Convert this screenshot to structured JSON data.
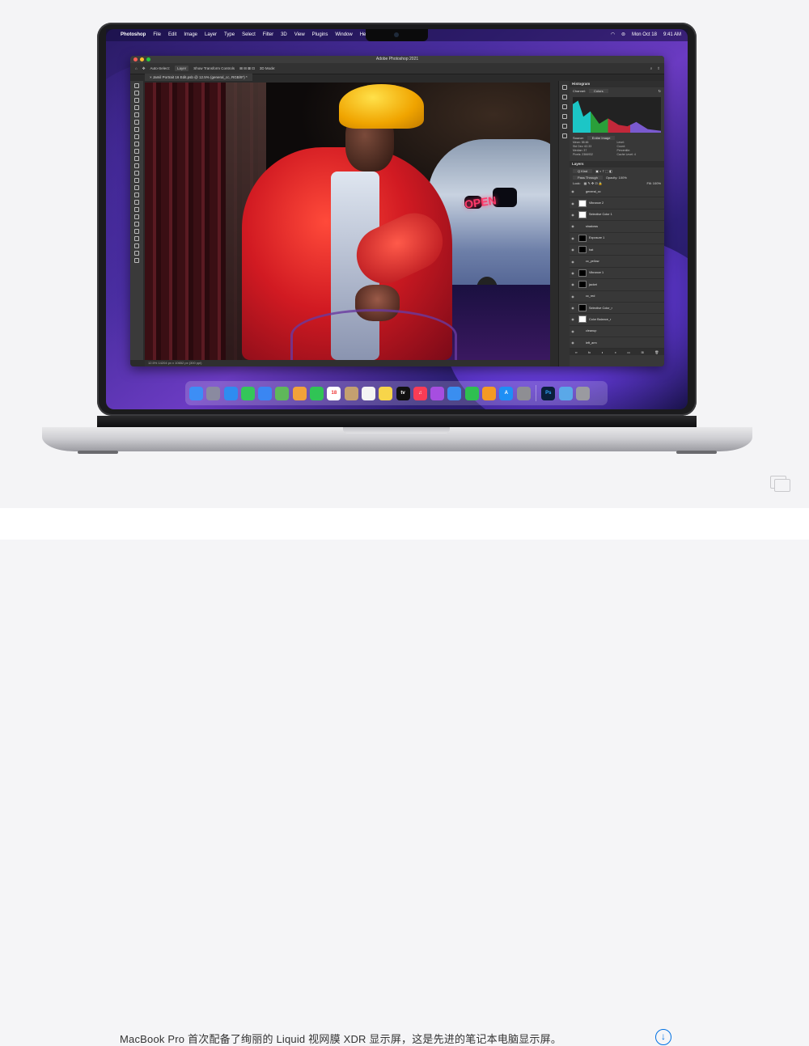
{
  "menubar": {
    "app": "Photoshop",
    "items": [
      "File",
      "Edit",
      "Image",
      "Layer",
      "Type",
      "Select",
      "Filter",
      "3D",
      "View",
      "Plugins",
      "Window",
      "Help"
    ],
    "clock": "Mon Oct 18",
    "time": "9:41 AM"
  },
  "photoshop": {
    "window_title": "Adobe Photoshop 2021",
    "options": {
      "auto_select": "Auto-Select:",
      "auto_select_value": "Layer",
      "show_transform": "Show Transform Controls",
      "mode_3d": "3D Mode:"
    },
    "doc_tab": "Jamil Portrait 16 Edit.psb @ 12.5% (general_cc, RGB/8*) *",
    "status": "12.5%     14204 px x 10652 px (300 ppi)",
    "neon_sign": "OPEN",
    "histogram": {
      "title": "Histogram",
      "channel_label": "Channel:",
      "channel_value": "Colors",
      "source_label": "Source:",
      "source_value": "Entire Image",
      "mean": "Mean:  58.66",
      "std_dev": "Std Dev:  62.33",
      "median": "Median:  37",
      "pixels": "Pixels:  2366932",
      "level": "Level:",
      "count": "Count:",
      "percentile": "Percentile:",
      "cache": "Cache Level:  4"
    },
    "layers": {
      "title": "Layers",
      "kind": "Q Kind",
      "blend": "Pass Through",
      "opacity": "Opacity: 100%",
      "lock": "Lock:",
      "fill": "Fill: 100%",
      "items": [
        {
          "name": "general_cc",
          "thumb": "none"
        },
        {
          "name": "Vibrance 2",
          "thumb": "light"
        },
        {
          "name": "Selective Color 1",
          "thumb": "light"
        },
        {
          "name": "shadows",
          "thumb": "none"
        },
        {
          "name": "Exposure 1",
          "thumb": "dark"
        },
        {
          "name": "hat",
          "thumb": "dark"
        },
        {
          "name": "cc_yellow",
          "thumb": "none"
        },
        {
          "name": "Vibrance 1",
          "thumb": "dark"
        },
        {
          "name": "jacket",
          "thumb": "dark"
        },
        {
          "name": "cc_red",
          "thumb": "none"
        },
        {
          "name": "Selective Color_r",
          "thumb": "dark"
        },
        {
          "name": "Color Balance_r",
          "thumb": "light"
        },
        {
          "name": "cleanup",
          "thumb": "none"
        },
        {
          "name": "left_arm",
          "thumb": "none"
        }
      ]
    }
  },
  "dock": {
    "apps": [
      {
        "icon": "finder-icon",
        "color": "#3d8ef5",
        "label": ""
      },
      {
        "icon": "launchpad-icon",
        "color": "#8a8aa0",
        "label": ""
      },
      {
        "icon": "safari-icon",
        "color": "#2e8cf0",
        "label": ""
      },
      {
        "icon": "messages-icon",
        "color": "#34c759",
        "label": ""
      },
      {
        "icon": "mail-icon",
        "color": "#3a86f2",
        "label": ""
      },
      {
        "icon": "maps-icon",
        "color": "#5fb85a",
        "label": ""
      },
      {
        "icon": "photos-icon",
        "color": "#f2a23a",
        "label": ""
      },
      {
        "icon": "facetime-icon",
        "color": "#30c455",
        "label": ""
      },
      {
        "icon": "calendar-icon",
        "color": "#ffffff",
        "label": "18"
      },
      {
        "icon": "contacts-icon",
        "color": "#c4a070",
        "label": ""
      },
      {
        "icon": "reminders-icon",
        "color": "#f4f4f4",
        "label": ""
      },
      {
        "icon": "notes-icon",
        "color": "#f7d54a",
        "label": ""
      },
      {
        "icon": "appletv-icon",
        "color": "#111111",
        "label": "tv"
      },
      {
        "icon": "music-icon",
        "color": "#fa3c55",
        "label": "♫"
      },
      {
        "icon": "podcasts-icon",
        "color": "#a64ee0",
        "label": ""
      },
      {
        "icon": "keynote-icon",
        "color": "#3a8ef0",
        "label": ""
      },
      {
        "icon": "numbers-icon",
        "color": "#2fbf50",
        "label": ""
      },
      {
        "icon": "pages-icon",
        "color": "#f59a23",
        "label": ""
      },
      {
        "icon": "appstore-icon",
        "color": "#1e8ff5",
        "label": "A"
      },
      {
        "icon": "settings-icon",
        "color": "#8e8e93",
        "label": ""
      },
      {
        "icon": "photoshop-icon",
        "color": "#0a1f3b",
        "label": "Ps"
      },
      {
        "icon": "downloads-icon",
        "color": "#5aa8e8",
        "label": ""
      },
      {
        "icon": "trash-icon",
        "color": "#9a9aa0",
        "label": ""
      }
    ]
  },
  "caption": {
    "text": "MacBook Pro 首次配备了绚丽的 Liquid 视网膜 XDR 显示屏，这是先进的笔记本电脑显示屏。"
  },
  "colors": {
    "accent": "#0071e3",
    "wallpaper": "#4a2ea0"
  }
}
